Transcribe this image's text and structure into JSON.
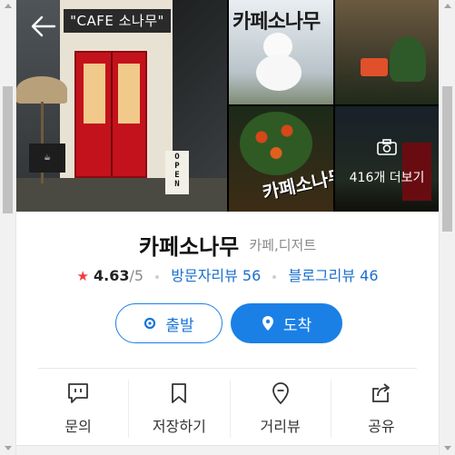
{
  "photos": {
    "main_sign_text": "\"CAFE 소나무\"",
    "more_label": "416개 더보기",
    "icons": {
      "back": "back-arrow-icon",
      "camera": "camera-icon"
    }
  },
  "place": {
    "name": "카페소나무",
    "category": "카페,디저트"
  },
  "rating": {
    "value": "4.63",
    "max": "/5",
    "visitor_reviews": "방문자리뷰 56",
    "blog_reviews": "블로그리뷰 46"
  },
  "buttons": {
    "start": "출발",
    "arrive": "도착"
  },
  "actions": [
    {
      "label": "문의",
      "icon": "chat-icon"
    },
    {
      "label": "저장하기",
      "icon": "bookmark-icon"
    },
    {
      "label": "거리뷰",
      "icon": "street-view-pin-icon"
    },
    {
      "label": "공유",
      "icon": "share-icon"
    }
  ],
  "colors": {
    "accent": "#1a80e6",
    "link": "#1a6fce",
    "star": "#f03c3c",
    "door_red": "#c4121c"
  }
}
